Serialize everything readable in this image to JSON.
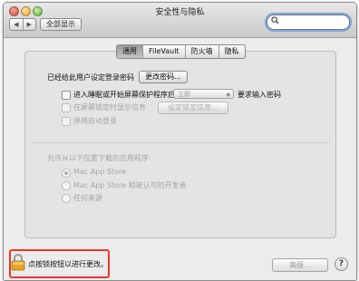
{
  "window": {
    "title": "安全性与隐私"
  },
  "toolbar": {
    "back_glyph": "◀",
    "forward_glyph": "▶",
    "show_all_label": "全部显示",
    "search_value": "",
    "search_icon": "search-icon"
  },
  "tabs": [
    {
      "label": "通用",
      "active": true
    },
    {
      "label": "FileVault",
      "active": false
    },
    {
      "label": "防火墙",
      "active": false
    },
    {
      "label": "隐私",
      "active": false
    }
  ],
  "general": {
    "password_set_text": "已经给此用户设定登录密码",
    "change_password_label": "更改密码...",
    "require_password": {
      "label_before": "进入睡眠或开始屏幕保护程序后",
      "select_value": "立即",
      "label_after": "要求输入密码",
      "checked": false
    },
    "show_message": {
      "label": "在屏幕锁定时显示信息",
      "button_label": "设定锁定信息...",
      "checked": false
    },
    "disable_auto_login": {
      "label": "停用自动登录",
      "checked": false
    },
    "download_section_title": "允许从以下位置下载的应用程序:",
    "download_options": [
      {
        "label": "Mac App Store",
        "selected": true
      },
      {
        "label": "Mac App Store 和被认可的开发者",
        "selected": false
      },
      {
        "label": "任何来源",
        "selected": false
      }
    ]
  },
  "footer": {
    "lock_text": "点按锁按钮以进行更改。",
    "advanced_label": "高级...",
    "help_label": "?"
  },
  "colors": {
    "highlight_border": "#e8392b",
    "search_focus_ring": "#7fa8e0"
  }
}
